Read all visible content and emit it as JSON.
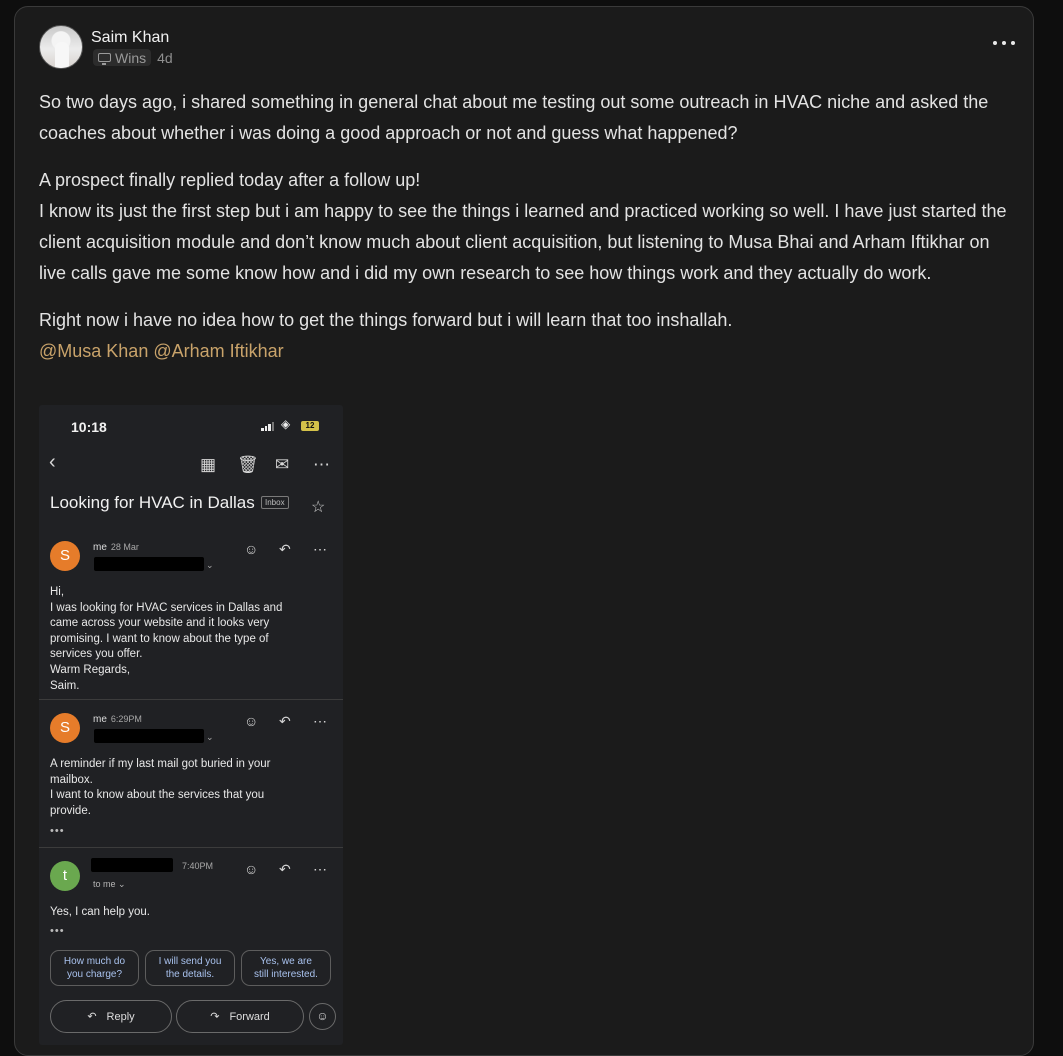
{
  "post": {
    "author": "Saim Khan",
    "category": "Wins",
    "age": "4d",
    "paragraphs": [
      "So two days ago, i shared something in general chat about me testing out some outreach in HVAC niche and asked the coaches about whether i was doing a good approach or not and guess what happened?",
      "A prospect finally replied today after a follow up!\nI know its just the first step but i am happy to see the things i learned and practiced working so well. I have just started the client acquisition module and don’t know much about client acquisition, but listening to Musa Bhai and Arham Iftikhar on live calls gave me some know how and i did my own research to see how things work and they actually do work.",
      "Right now i have no idea how to get the things forward but i will learn that too inshallah."
    ],
    "mentions": "@Musa Khan @Arham Iftikhar",
    "colors": {
      "mention": "#c9a36a",
      "card_bg": "#1b1b1b",
      "page_bg": "#0e0e0e"
    }
  },
  "screenshot": {
    "time": "10:18",
    "battery": "12",
    "subject": "Looking for HVAC in Dallas",
    "label": "Inbox",
    "messages": [
      {
        "avatar": "S",
        "avatar_color": "#e67c2a",
        "sender": "me",
        "time": "28 Mar",
        "body": "Hi,\n I was looking for HVAC services in Dallas and\ncame across your website and it looks very\npromising. I want to know about the type of\nservices you offer.\nWarm Regards,\nSaim."
      },
      {
        "avatar": "S",
        "avatar_color": "#e67c2a",
        "sender": "me",
        "time": "6:29PM",
        "body": "A reminder if my last mail got buried in your\nmailbox.\nI want to know about the services that you\nprovide."
      },
      {
        "avatar": "t",
        "avatar_color": "#6aa84f",
        "sender": "",
        "time": "7:40PM",
        "recipient": "to me",
        "body": "Yes, I can help you."
      }
    ],
    "smart_replies": [
      "How much do\nyou charge?",
      "I will send you\nthe details.",
      "Yes, we are\nstill interested."
    ],
    "reply_label": "Reply",
    "forward_label": "Forward"
  }
}
